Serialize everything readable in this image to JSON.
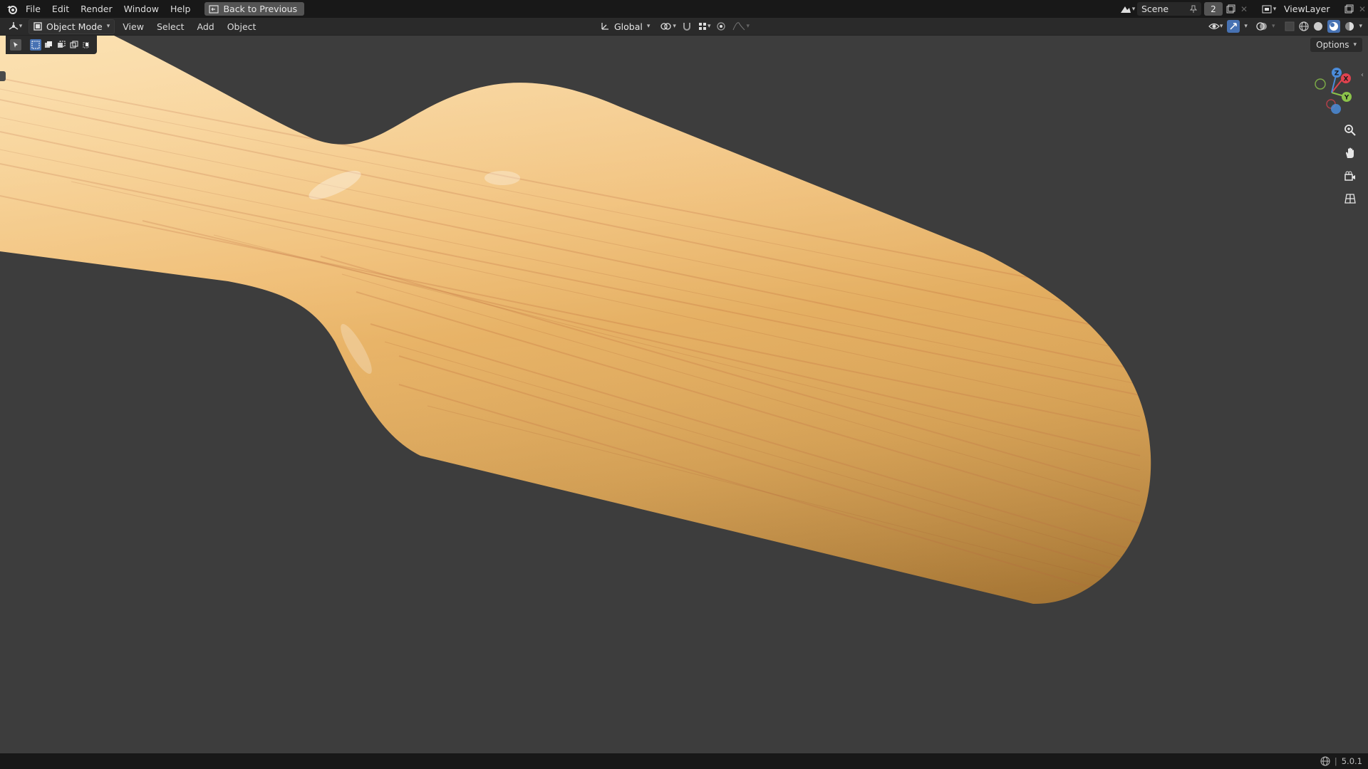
{
  "topbar": {
    "menus": [
      "File",
      "Edit",
      "Render",
      "Window",
      "Help"
    ],
    "back_button": "Back to Previous",
    "scene_name": "Scene",
    "scene_count": "2",
    "view_layer": "ViewLayer"
  },
  "header": {
    "mode": "Object Mode",
    "menus": [
      "View",
      "Select",
      "Add",
      "Object"
    ],
    "transform_orientation": "Global"
  },
  "viewport": {
    "options_label": "Options",
    "gizmo": {
      "x_label": "X",
      "y_label": "Y",
      "z_label": "Z"
    },
    "colors": {
      "background": "#3d3d3d",
      "wood_light": "#f4c27c",
      "wood_dark": "#c98b3c",
      "axis_x": "#e0424f",
      "axis_y": "#8bc34a",
      "axis_z": "#4b8bd8"
    }
  },
  "statusbar": {
    "version": "5.0.1"
  }
}
